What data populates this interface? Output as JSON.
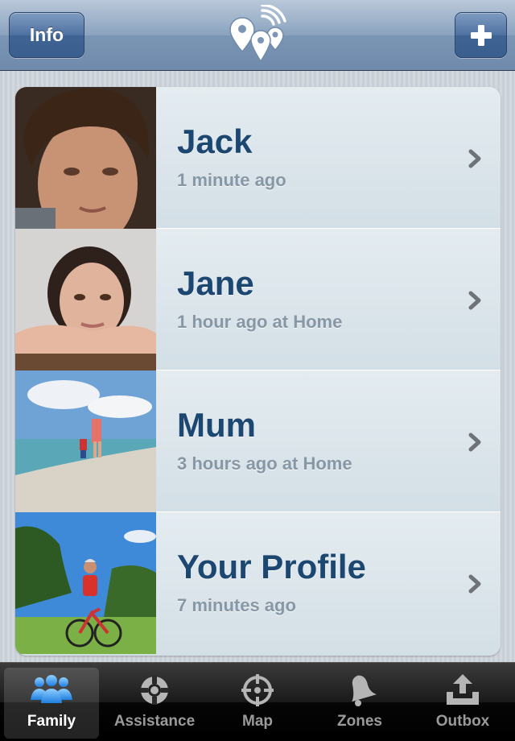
{
  "navbar": {
    "info_label": "Info",
    "add_label": "+",
    "logo_icon": "location-pins-signal-icon"
  },
  "people": [
    {
      "name": "Jack",
      "time": "1 minute ago",
      "photo": "boy-portrait"
    },
    {
      "name": "Jane",
      "time": "1 hour ago at Home",
      "photo": "girl-portrait"
    },
    {
      "name": "Mum",
      "time": "3 hours ago at Home",
      "photo": "beach-photo"
    },
    {
      "name": "Your Profile",
      "time": "7 minutes ago",
      "photo": "cyclist-photo"
    }
  ],
  "tabs": [
    {
      "label": "Family",
      "icon": "family-icon",
      "active": true
    },
    {
      "label": "Assistance",
      "icon": "lifebuoy-icon",
      "active": false
    },
    {
      "label": "Map",
      "icon": "crosshair-icon",
      "active": false
    },
    {
      "label": "Zones",
      "icon": "bell-icon",
      "active": false
    },
    {
      "label": "Outbox",
      "icon": "outbox-icon",
      "active": false
    }
  ],
  "colors": {
    "name_text": "#1c4770",
    "time_text": "#8797a5",
    "nav_button": "#3f6393",
    "tab_active_label": "#ffffff",
    "tab_inactive_label": "#9a9a9a"
  }
}
